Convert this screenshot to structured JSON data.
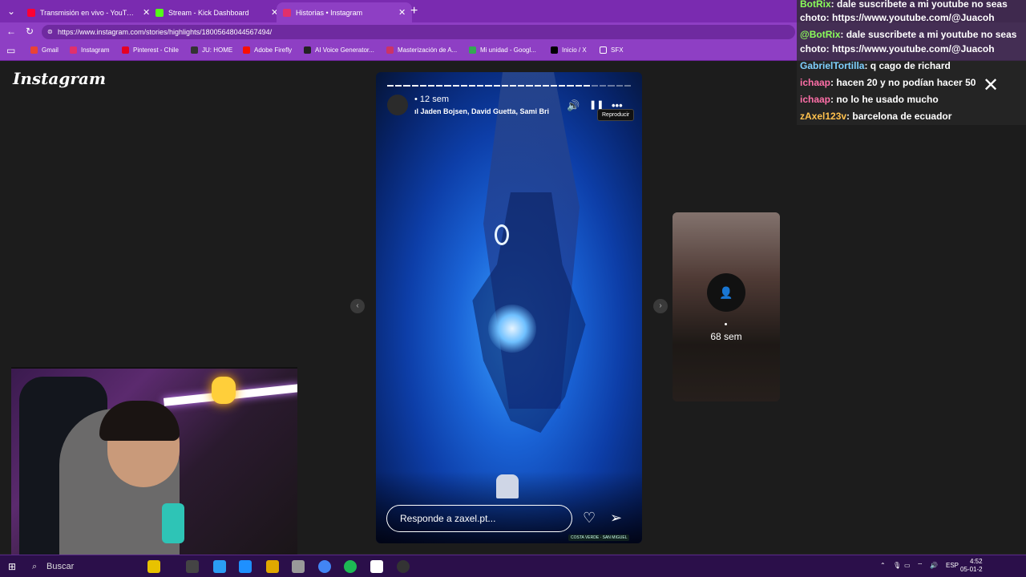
{
  "tabs": [
    {
      "label": "Transmisión en vivo - YouTube St..",
      "color": "#ff0033"
    },
    {
      "label": "Stream - Kick Dashboard",
      "color": "#53fc18"
    },
    {
      "label": "Historias • Instagram",
      "color": "#e1306c"
    }
  ],
  "address": {
    "url": "https://www.instagram.com/stories/highlights/18005648044567494/"
  },
  "bookmarks": [
    {
      "label": "Gmail",
      "color": "#ea4335"
    },
    {
      "label": "Instagram",
      "color": "#e1306c"
    },
    {
      "label": "Pinterest - Chile",
      "color": "#e60023"
    },
    {
      "label": "JU: HOME",
      "color": "#333333"
    },
    {
      "label": "Adobe Firefly",
      "color": "#fa0f00"
    },
    {
      "label": "AI Voice Generator...",
      "color": "#222222"
    },
    {
      "label": "Masterización de A...",
      "color": "#cc3366"
    },
    {
      "label": "Mi unidad - Googl...",
      "color": "#34a853"
    },
    {
      "label": "Inicio / X",
      "color": "#000000"
    },
    {
      "label": "SFX",
      "color": "#e6b800"
    }
  ],
  "instagram": {
    "logo": "Instagram",
    "story": {
      "time": "12 sem",
      "music": "Jaden Bojsen, David Guetta, Sami Bri",
      "tooltip": "Reproducir",
      "reply_placeholder": "Responde a zaxel.pt...",
      "tag": "COSTA VERDE · SAN MIGUEL",
      "segments_total": 30,
      "segments_viewed": 25
    },
    "next_story": {
      "age": "68 sem"
    }
  },
  "chat": [
    {
      "user": "BotRix",
      "text": ": dale suscribete a mi youtube no seas",
      "color": "#8bff5a"
    },
    {
      "user": "",
      "text": "choto: https://www.youtube.com/@Juacoh",
      "color": "#ffffff"
    },
    {
      "user": "@BotRix",
      "text": ": dale suscribete a mi youtube no seas",
      "color": "#8bff5a"
    },
    {
      "user": "",
      "text": "choto: https://www.youtube.com/@Juacoh",
      "color": "#ffffff"
    },
    {
      "user": "GabrielTortilla",
      "text": ": q cago de richard",
      "color": "#7fd1ff"
    },
    {
      "user": "ichaap",
      "text": ": hacen 20 y no podían hacer 50",
      "color": "#ff6fa8"
    },
    {
      "user": "ichaap",
      "text": ": no lo he usado mucho",
      "color": "#ff6fa8"
    },
    {
      "user": "zAxel123v",
      "text": ": barcelona de ecuador",
      "color": "#ffc14d"
    }
  ],
  "taskbar": {
    "search": "Buscar",
    "lang": "ESP",
    "time": "4:52",
    "date": "05-01-2"
  }
}
